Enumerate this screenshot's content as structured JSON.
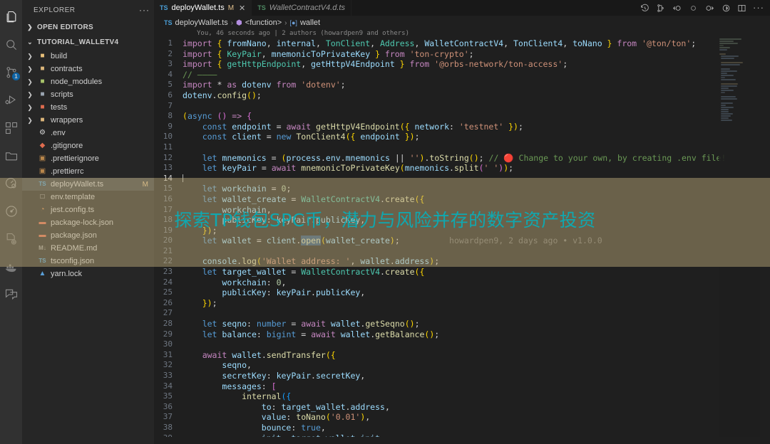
{
  "activity_bar": {
    "items": [
      {
        "name": "explorer-icon",
        "label": "Explorer",
        "active": true,
        "badge": null
      },
      {
        "name": "search-icon",
        "label": "Search",
        "active": false,
        "badge": null
      },
      {
        "name": "source-control-icon",
        "label": "Source Control",
        "active": false,
        "badge": "1"
      },
      {
        "name": "run-and-debug-icon",
        "label": "Run and Debug",
        "active": false,
        "badge": null
      },
      {
        "name": "extensions-icon",
        "label": "Extensions",
        "active": false,
        "badge": null
      },
      {
        "name": "remote-explorer-icon",
        "label": "Remote Explorer",
        "active": false,
        "badge": null
      },
      {
        "name": "testing-icon",
        "label": "Testing",
        "active": false,
        "badge": null
      },
      {
        "name": "git-graph-icon",
        "label": "Git Graph",
        "active": false,
        "badge": null
      },
      {
        "name": "copilot-icon",
        "label": "Copilot",
        "active": false,
        "badge": null
      },
      {
        "name": "docker-icon",
        "label": "Docker",
        "active": false,
        "badge": null
      },
      {
        "name": "chat-icon",
        "label": "Chat",
        "active": false,
        "badge": null
      }
    ]
  },
  "sidebar": {
    "title": "EXPLORER",
    "more_actions": "···",
    "open_editors_label": "OPEN EDITORS",
    "project_label": "TUTORIAL_WALLETV4",
    "folders": [
      {
        "label": "build",
        "icon": "folder-build",
        "color": "#e8c07a"
      },
      {
        "label": "contracts",
        "icon": "folder-contracts",
        "color": "#dcb67a"
      },
      {
        "label": "node_modules",
        "icon": "folder-node-modules",
        "color": "#a8c46a"
      },
      {
        "label": "scripts",
        "icon": "folder-scripts",
        "color": "#9aa5b1"
      },
      {
        "label": "tests",
        "icon": "folder-tests",
        "color": "#e06c4f"
      },
      {
        "label": "wrappers",
        "icon": "folder-wrappers",
        "color": "#dcb67a"
      }
    ],
    "files": [
      {
        "label": ".env",
        "icon": "gear-icon",
        "glyph": "⚙",
        "color": "#d4d4d4",
        "modified": "",
        "selected": false
      },
      {
        "label": ".gitignore",
        "icon": "git-icon",
        "glyph": "◆",
        "color": "#e06c4f",
        "modified": "",
        "selected": false
      },
      {
        "label": ".prettierignore",
        "icon": "prettier-icon",
        "glyph": "▣",
        "color": "#b8864b",
        "modified": "",
        "selected": false
      },
      {
        "label": ".prettierrc",
        "icon": "prettier-icon",
        "glyph": "▣",
        "color": "#b8864b",
        "modified": "",
        "selected": false
      },
      {
        "label": "deployWallet.ts",
        "icon": "typescript-icon",
        "glyph": "TS",
        "color": "#4a9fd8",
        "modified": "M",
        "selected": true
      },
      {
        "label": "env.template",
        "icon": "file-icon",
        "glyph": "□",
        "color": "#c5c5c5",
        "modified": "",
        "selected": false
      },
      {
        "label": "jest.config.ts",
        "icon": "jest-icon",
        "glyph": "◔",
        "color": "#d4864b",
        "modified": "",
        "selected": false
      },
      {
        "label": "package-lock.json",
        "icon": "npm-icon",
        "glyph": "▬",
        "color": "#e06c4f",
        "modified": "",
        "selected": false
      },
      {
        "label": "package.json",
        "icon": "npm-icon",
        "glyph": "▬",
        "color": "#e06c4f",
        "modified": "",
        "selected": false
      },
      {
        "label": "README.md",
        "icon": "markdown-icon",
        "glyph": "M↓",
        "color": "#9a9a9a",
        "modified": "",
        "selected": false
      },
      {
        "label": "tsconfig.json",
        "icon": "tsconfig-icon",
        "glyph": "TS",
        "color": "#4a9fd8",
        "modified": "",
        "selected": false
      },
      {
        "label": "yarn.lock",
        "icon": "yarn-icon",
        "glyph": "▲",
        "color": "#5a9fd8",
        "modified": "",
        "selected": false
      }
    ]
  },
  "tabs": [
    {
      "label": "deployWallet.ts",
      "badge": "TS",
      "modified": "M",
      "close": "✕",
      "active": true,
      "italic": false
    },
    {
      "label": "WalletContractV4.d.ts",
      "badge": "TS",
      "modified": "",
      "close": "",
      "active": false,
      "italic": true
    }
  ],
  "editor_actions": [
    {
      "name": "timeline-icon",
      "label": "Timeline"
    },
    {
      "name": "run-test-icon",
      "label": "Run Test"
    },
    {
      "name": "step-back-icon",
      "label": "Step Back"
    },
    {
      "name": "record-icon",
      "label": "Record"
    },
    {
      "name": "step-forward-icon",
      "label": "Step Forward"
    },
    {
      "name": "run-icon",
      "label": "Run"
    },
    {
      "name": "split-editor-icon",
      "label": "Split Editor"
    },
    {
      "name": "more-actions-icon",
      "label": "More Actions..."
    }
  ],
  "breadcrumb": {
    "file_badge": "TS",
    "file": "deployWallet.ts",
    "sep": "›",
    "symbol_glyph": "⬢",
    "symbol": "<function>",
    "var_glyph": "[●]",
    "variable": "wallet"
  },
  "blame_header": "You, 46 seconds ago | 2 authors (howardpen9 and others)",
  "inline_blame": "howardpen9, 2 days ago • v1.0.0",
  "overlay": {
    "text": "探索TP钱包SPC币，潜力与风险并存的数字资产投资",
    "color": "#0fa8b0",
    "band_color": "#6d6453"
  },
  "code": {
    "lines": [
      {
        "n": 1,
        "indent": 0,
        "cursor": false
      },
      {
        "n": 2,
        "indent": 0,
        "cursor": false
      },
      {
        "n": 3,
        "indent": 0,
        "cursor": false
      },
      {
        "n": 4,
        "indent": 0,
        "cursor": false
      },
      {
        "n": 5,
        "indent": 0,
        "cursor": false
      },
      {
        "n": 6,
        "indent": 0,
        "cursor": false
      },
      {
        "n": 7,
        "indent": 0,
        "cursor": false
      },
      {
        "n": 8,
        "indent": 0,
        "cursor": false
      },
      {
        "n": 9,
        "indent": 1,
        "cursor": false
      },
      {
        "n": 10,
        "indent": 1,
        "cursor": false
      },
      {
        "n": 11,
        "indent": 0,
        "cursor": false
      },
      {
        "n": 12,
        "indent": 1,
        "cursor": false
      },
      {
        "n": 13,
        "indent": 1,
        "cursor": false
      },
      {
        "n": 14,
        "indent": 0,
        "cursor": true
      },
      {
        "n": 15,
        "indent": 1,
        "cursor": false
      },
      {
        "n": 16,
        "indent": 1,
        "cursor": false
      },
      {
        "n": 17,
        "indent": 2,
        "cursor": false
      },
      {
        "n": 18,
        "indent": 2,
        "cursor": false
      },
      {
        "n": 19,
        "indent": 1,
        "cursor": false
      },
      {
        "n": 20,
        "indent": 1,
        "cursor": false
      },
      {
        "n": 21,
        "indent": 0,
        "cursor": false
      },
      {
        "n": 22,
        "indent": 1,
        "cursor": false
      },
      {
        "n": 23,
        "indent": 1,
        "cursor": false
      },
      {
        "n": 24,
        "indent": 2,
        "cursor": false
      },
      {
        "n": 25,
        "indent": 2,
        "cursor": false
      },
      {
        "n": 26,
        "indent": 1,
        "cursor": false
      },
      {
        "n": 27,
        "indent": 0,
        "cursor": false
      },
      {
        "n": 28,
        "indent": 1,
        "cursor": false
      },
      {
        "n": 29,
        "indent": 1,
        "cursor": false
      },
      {
        "n": 30,
        "indent": 0,
        "cursor": false
      },
      {
        "n": 31,
        "indent": 1,
        "cursor": false
      },
      {
        "n": 32,
        "indent": 2,
        "cursor": false
      },
      {
        "n": 33,
        "indent": 2,
        "cursor": false
      },
      {
        "n": 34,
        "indent": 2,
        "cursor": false
      },
      {
        "n": 35,
        "indent": 3,
        "cursor": false
      },
      {
        "n": 36,
        "indent": 4,
        "cursor": false
      },
      {
        "n": 37,
        "indent": 4,
        "cursor": false
      },
      {
        "n": 38,
        "indent": 4,
        "cursor": false
      },
      {
        "n": 39,
        "indent": 4,
        "cursor": false
      }
    ],
    "text": {
      "l1": "import { fromNano, internal, TonClient, Address, WalletContractV4, TonClient4, toNano } from '@ton/ton';",
      "l2": "import { KeyPair, mnemonicToPrivateKey } from 'ton-crypto';",
      "l3": "import { getHttpEndpoint, getHttpV4Endpoint } from '@orbs-network/ton-access';",
      "l4": "// ————",
      "l5": "import * as dotenv from 'dotenv';",
      "l6": "dotenv.config();",
      "l7": "",
      "l8": "(async () => {",
      "l9": "const endpoint = await getHttpV4Endpoint({ network: 'testnet' });",
      "l10": "const client = new TonClient4({ endpoint });",
      "l11": "",
      "l12": "let mnemonics = (process.env.mnemonics || '').toString(); // 🔴 Change to your own, by creating .env file!",
      "l13": "let keyPair = await mnemonicToPrivateKey(mnemonics.split(' '));",
      "l14": "",
      "l15": "let workchain = 0;",
      "l16": "let wallet_create = WalletContractV4.create({",
      "l17": "workchain,",
      "l18": "publicKey: keyPair.publicKey,",
      "l19": "});",
      "l20": "let wallet = client.open(wallet_create);",
      "l21": "",
      "l22": "console.log('Wallet address: ', wallet.address);",
      "l23": "let target_wallet = WalletContractV4.create({",
      "l24": "workchain: 0,",
      "l25": "publicKey: keyPair.publicKey,",
      "l26": "});",
      "l27": "",
      "l28": "let seqno: number = await wallet.getSeqno();",
      "l29": "let balance: bigint = await wallet.getBalance();",
      "l30": "",
      "l31": "await wallet.sendTransfer({",
      "l32": "seqno,",
      "l33": "secretKey: keyPair.secretKey,",
      "l34": "messages: [",
      "l35": "internal({",
      "l36": "to: target_wallet.address,",
      "l37": "value: toNano('0.01'),",
      "l38": "bounce: true,",
      "l39": "init: target_wallet.init,"
    }
  }
}
